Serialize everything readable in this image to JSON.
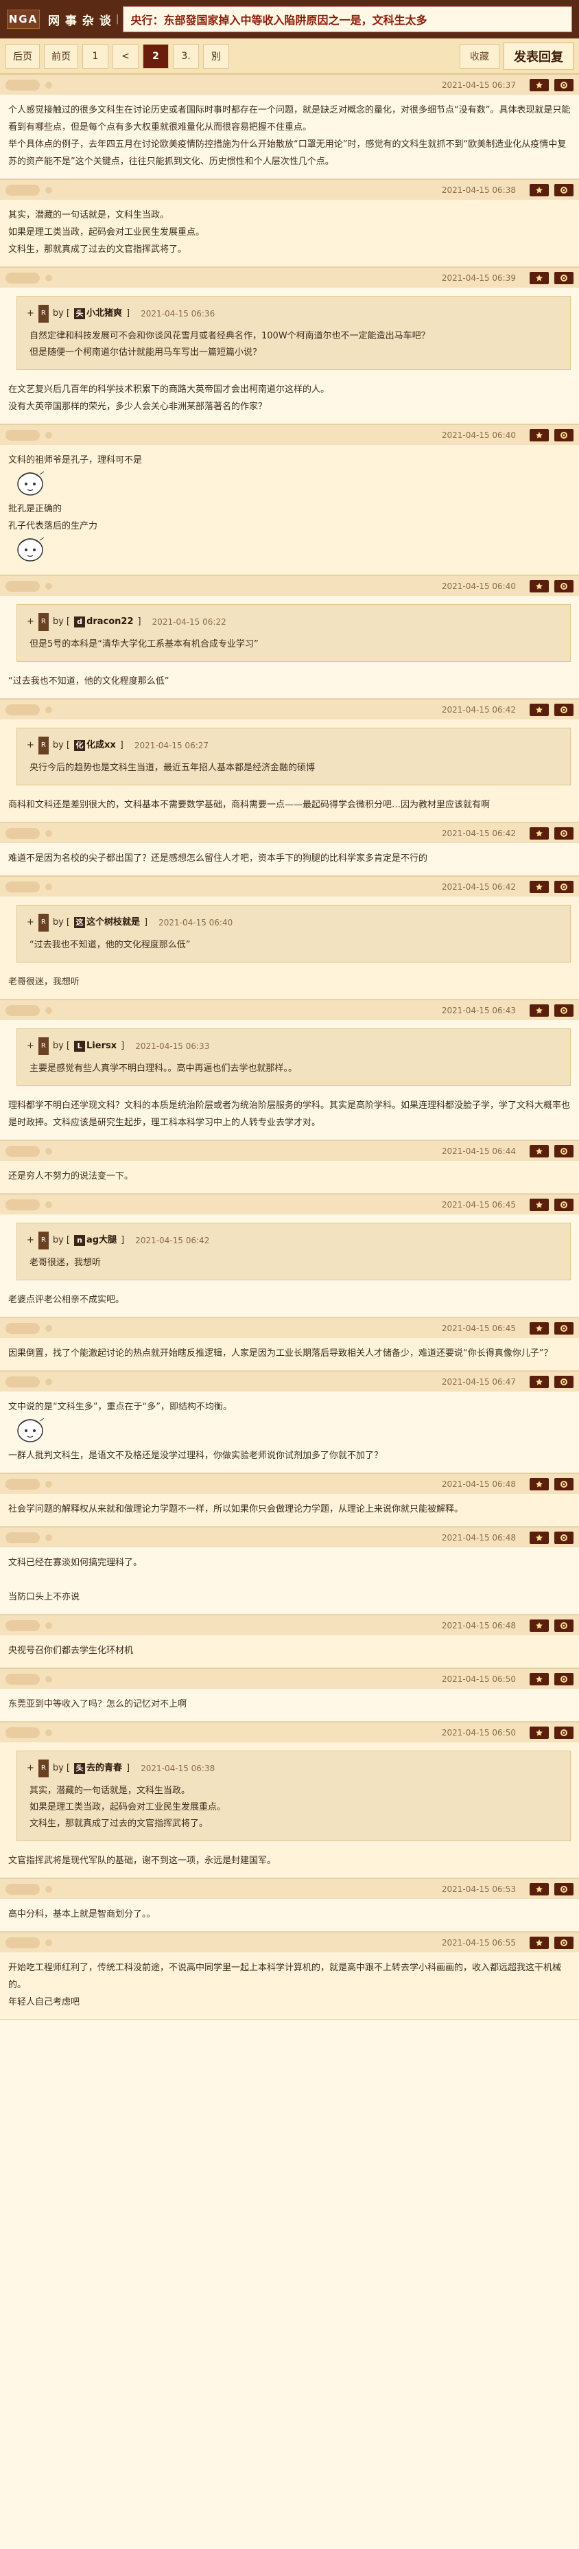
{
  "header": {
    "logo": "NGA",
    "board": "网 事 杂 谈",
    "separator": "|",
    "title": "央行：东部發国家掉入中等收入陷阱原因之一是，文科生太多"
  },
  "nav": {
    "back": "后页",
    "prev": "前页",
    "pages": [
      "1",
      "<",
      "2",
      "3.",
      "別"
    ],
    "current_index": 3,
    "collect": "收藏",
    "reply": "发表回复"
  },
  "icons": {
    "star": "star-icon",
    "settings": "gear-icon",
    "quote_badge": "R",
    "quote_prefix": "+"
  },
  "posts": [
    {
      "time": "2021-04-15 06:37",
      "lines": [
        "个人感觉接触过的很多文科生在讨论历史或者国际时事时都存在一个问题，就是缺乏对概念的量化，对很多细节点“没有数”。具体表现就是只能看到有哪些点，但是每个点有多大权重就很难量化从而很容易把握不住重点。",
        "举个具体点的例子，去年四五月在讨论欧美疫情防控措施为什么开始散放“口罩无用论”时，感觉有的文科生就抓不到“欧美制造业化从疫情中复苏的资产能不是”这个关键点，往往只能抓到文化、历史惯性和个人层次性几个点。"
      ]
    },
    {
      "time": "2021-04-15 06:38",
      "lines": [
        "其实，潜藏的一句话就是，文科生当政。",
        "如果是理工类当政，起码会对工业民生发展重点。",
        "文科生，那就真成了过去的文官指挥武将了。"
      ]
    },
    {
      "time": "2021-04-15 06:39",
      "quote": {
        "user": "小北猪爽",
        "init": "头",
        "time": "2021-04-15 06:36",
        "lines": [
          "自然定律和科技发展可不会和你谈风花雪月或者经典名作，100W个柯南道尔也不一定能造出马车吧？",
          "但是随便一个柯南道尔估计就能用马车写出一篇短篇小说？"
        ]
      },
      "lines": [
        "在文艺复兴后几百年的科学技术积累下的商路大英帝国才会出柯南道尔这样的人。",
        "没有大英帝国那样的荣光，多少人会关心非洲某部落著名的作家？"
      ]
    },
    {
      "time": "2021-04-15 06:40",
      "lines": [
        "文科的祖师爷是孔子，理科可不是",
        "批孔是正确的",
        "孔子代表落后的生产力"
      ],
      "stickers": [
        1,
        2
      ]
    },
    {
      "time": "2021-04-15 06:40",
      "quote": {
        "user": "dracon22",
        "init": "d",
        "time": "2021-04-15 06:22",
        "lines": [
          "但是5号的本科是“清华大学化工系基本有机合成专业学习”"
        ]
      },
      "lines": [
        "“过去我也不知道，他的文化程度那么低”"
      ]
    },
    {
      "time": "2021-04-15 06:42",
      "quote": {
        "user": "化成xx",
        "init": "化",
        "time": "2021-04-15 06:27",
        "lines": [
          "央行今后的趋势也是文科生当道，最近五年招人基本都是经济金融的硕博"
        ]
      },
      "lines": [
        "商科和文科还是差别很大的，文科基本不需要数学基础，商科需要一点——最起码得学会微积分吧…因为教材里应该就有啊"
      ]
    },
    {
      "time": "2021-04-15 06:42",
      "lines": [
        "难道不是因为名校的尖子都出国了？还是感想怎么留住人才吧，资本手下的狗腿的比科学家多肯定是不行的"
      ]
    },
    {
      "time": "2021-04-15 06:42",
      "quote": {
        "user": "这个树枝就是",
        "init": "这",
        "time": "2021-04-15 06:40",
        "lines": [
          "“过去我也不知道，他的文化程度那么低”"
        ]
      },
      "lines": [
        "老哥很迷，我想听"
      ]
    },
    {
      "time": "2021-04-15 06:43",
      "quote": {
        "user": "Liersx",
        "init": "L",
        "time": "2021-04-15 06:33",
        "lines": [
          "主要是感觉有些人真学不明白理科。。高中再逼也们去学也就那样。。"
        ]
      },
      "lines": [
        "理科都学不明白还学现文科？文科的本质是统治阶层或者为统治阶层服务的学科。其实是高阶学科。如果连理科都没脸子学，学了文科大概率也是时政捧。文科应该是研究生起步，理工科本科学习中上的人转专业去学才对。"
      ]
    },
    {
      "time": "2021-04-15 06:44",
      "lines": [
        "还是穷人不努力的说法变一下。"
      ]
    },
    {
      "time": "2021-04-15 06:45",
      "quote": {
        "user": "ag大腿",
        "init": "n",
        "time": "2021-04-15 06:42",
        "lines": [
          "老哥很迷，我想听"
        ]
      },
      "lines": [
        "老婆点评老公相亲不成实吧。"
      ]
    },
    {
      "time": "2021-04-15 06:45",
      "lines": [
        "因果倒置，找了个能激起讨论的热点就开始瞎反推逻辑，人家是因为工业长期落后导致相关人才储备少，难道还要说“你长得真像你儿子”？"
      ]
    },
    {
      "time": "2021-04-15 06:47",
      "lines": [
        "文中说的是“文科生多”，重点在于“多”，即结构不均衡。",
        "一群人批判文科生，是语文不及格还是没学过理科，你做实验老师说你试剂加多了你就不加了？"
      ],
      "stickers": [
        3
      ]
    },
    {
      "time": "2021-04-15 06:48",
      "lines": [
        "社会学问题的解释权从来就和做理论力学题不一样，所以如果你只会做理论力学题，从理论上来说你就只能被解释。"
      ]
    },
    {
      "time": "2021-04-15 06:48",
      "lines": [
        "文科已经在寡淡如何搞完理科了。",
        "",
        "当防口头上不亦说"
      ]
    },
    {
      "time": "2021-04-15 06:48",
      "lines": [
        "央视号召你们都去学生化环材机"
      ]
    },
    {
      "time": "2021-04-15 06:50",
      "lines": [
        "东莞亚到中等收入了吗？怎么的记忆对不上啊"
      ]
    },
    {
      "time": "2021-04-15 06:50",
      "quote": {
        "user": "去的青春",
        "init": "头",
        "time": "2021-04-15 06:38",
        "lines": [
          "其实，潜藏的一句话就是，文科生当政。",
          "如果是理工类当政，起码会对工业民生发展重点。",
          "文科生，那就真成了过去的文官指挥武将了。"
        ]
      },
      "lines": [
        "文官指挥武将是现代军队的基础，谢不到这一项，永远是封建国军。"
      ]
    },
    {
      "time": "2021-04-15 06:53",
      "lines": [
        "高中分科，基本上就是智商划分了。。"
      ]
    },
    {
      "time": "2021-04-15 06:55",
      "lines": [
        "开始吃工程师红利了，传统工科没前途，不说高中同学里一起上本科学计算机的，就是高中跟不上转去学小科画画的，收入都远超我这干机械的。",
        "年轻人自己考虑吧"
      ]
    }
  ]
}
